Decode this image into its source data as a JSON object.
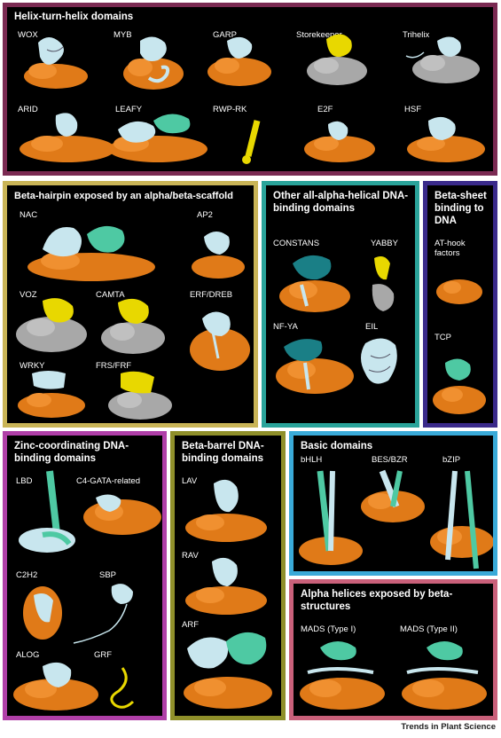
{
  "colors": {
    "border_hth": "#7a2a52",
    "border_beta_hairpin": "#c9b457",
    "border_alpha": "#2aa39a",
    "border_beta_sheet": "#3a2a8a",
    "border_zinc": "#b03fa8",
    "border_beta_barrel": "#8f8f2a",
    "border_basic": "#3aaad8",
    "border_alpha_beta": "#c9607a",
    "dna_orange": "#e07a18",
    "dna_grey": "#a8a8a8",
    "protein_lightblue": "#c8e6ee",
    "protein_green": "#4ec9a3",
    "protein_teal": "#1a7f86",
    "protein_yellow": "#e8d800"
  },
  "panels": {
    "hth": {
      "title": "Helix-turn-helix domains",
      "labels": [
        "WOX",
        "MYB",
        "GARP",
        "Storekeeper",
        "Trihelix",
        "ARID",
        "LEAFY",
        "RWP-RK",
        "E2F",
        "HSF"
      ]
    },
    "beta_hairpin": {
      "title": "Beta-hairpin exposed by an alpha/beta-scaffold",
      "labels": [
        "NAC",
        "AP2",
        "VOZ",
        "CAMTA",
        "ERF/DREB",
        "WRKY",
        "FRS/FRF"
      ]
    },
    "alpha": {
      "title": "Other all-alpha-helical DNA-binding domains",
      "labels": [
        "CONSTANS",
        "YABBY",
        "NF-YA",
        "EIL"
      ]
    },
    "beta_sheet": {
      "title": "Beta-sheet binding to DNA",
      "labels": [
        "AT-hook factors",
        "TCP"
      ]
    },
    "zinc": {
      "title": "Zinc-coordinating DNA-binding domains",
      "labels": [
        "LBD",
        "C4-GATA-related",
        "C2H2",
        "SBP",
        "ALOG",
        "GRF"
      ]
    },
    "beta_barrel": {
      "title": "Beta-barrel DNA-binding domains",
      "labels": [
        "LAV",
        "RAV",
        "ARF"
      ]
    },
    "basic": {
      "title": "Basic domains",
      "labels": [
        "bHLH",
        "BES/BZR",
        "bZIP"
      ]
    },
    "alpha_beta": {
      "title": "Alpha helices exposed by beta-structures",
      "labels": [
        "MADS (Type I)",
        "MADS (Type II)"
      ]
    }
  },
  "footer": "Trends in Plant Science"
}
